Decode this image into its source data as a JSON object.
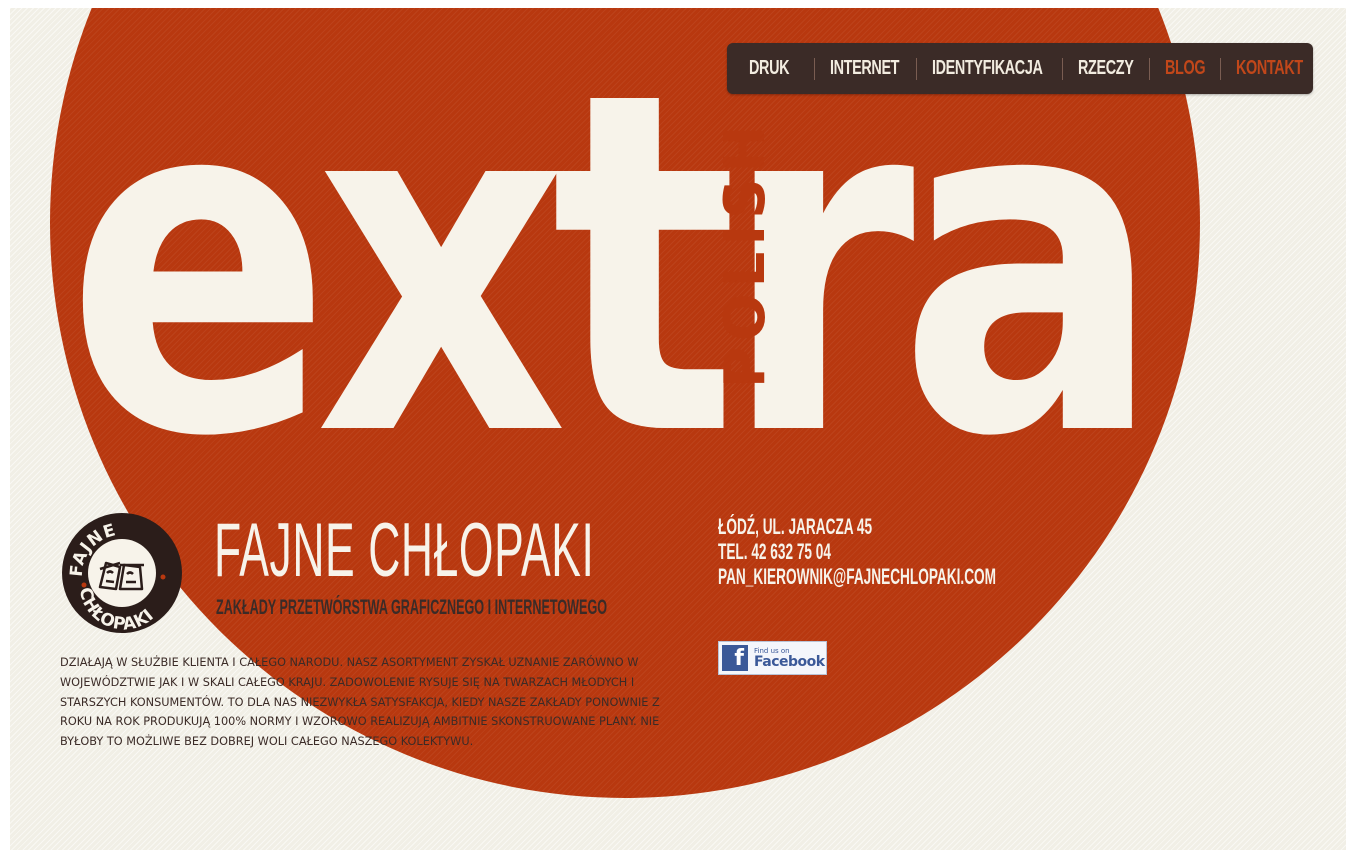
{
  "nav": {
    "items": [
      {
        "label": "DRUK",
        "accent": false
      },
      {
        "label": "INTERNET",
        "accent": false
      },
      {
        "label": "IDENTYFIKACJA",
        "accent": false
      },
      {
        "label": "RZECZY",
        "accent": false
      },
      {
        "label": "BLOG",
        "accent": true
      },
      {
        "label": "KONTAKT",
        "accent": true
      }
    ]
  },
  "hero": {
    "word": "extra",
    "side_word": "POLISH"
  },
  "logo": {
    "top_text": "FAJNE",
    "bottom_text": "CHŁOPAKI"
  },
  "brand": {
    "title": "FAJNE CHŁOPAKI",
    "subtitle": "ZAKŁADY PRZETWÓRSTWA GRAFICZNEGO I INTERNETOWEGO"
  },
  "contact": {
    "address": "ŁÓDŹ, UL. JARACZA 45",
    "phone": "TEL. 42 632 75 04",
    "email": "PAN_KIEROWNIK@FAJNECHLOPAKI.COM"
  },
  "facebook": {
    "small": "Find us on",
    "big": "Facebook",
    "glyph": "f"
  },
  "description": "DZIAŁAJĄ W SŁUŻBIE KLIENTA I CAŁEGO NARODU. NASZ ASORTYMENT ZYSKAŁ UZNANIE ZARÓWNO W WOJEWÓDZTWIE JAK I W SKALI CAŁEGO KRAJU. ZADOWOLENIE RYSUJE SIĘ NA TWARZACH MŁODYCH I STARSZYCH KONSUMENTÓW. TO DLA NAS NIEZWYKŁA SATYSFAKCJA, KIEDY NASZE ZAKŁADY PONOWNIE Z ROKU NA ROK PRODUKUJĄ 100% NORMY I WZOROWO REALIZUJĄ AMBITNIE SKONSTRUOWANE PLANY. NIE BYŁOBY TO MOŻLIWE BEZ DOBREJ WOLI CAŁEGO NASZEGO KOLEKTYWU.",
  "colors": {
    "brand_red": "#b8380f",
    "cream": "#f7f3ea",
    "dark_brown": "#3b2b27",
    "background": "#f1efe6",
    "facebook_blue": "#3b5998"
  }
}
